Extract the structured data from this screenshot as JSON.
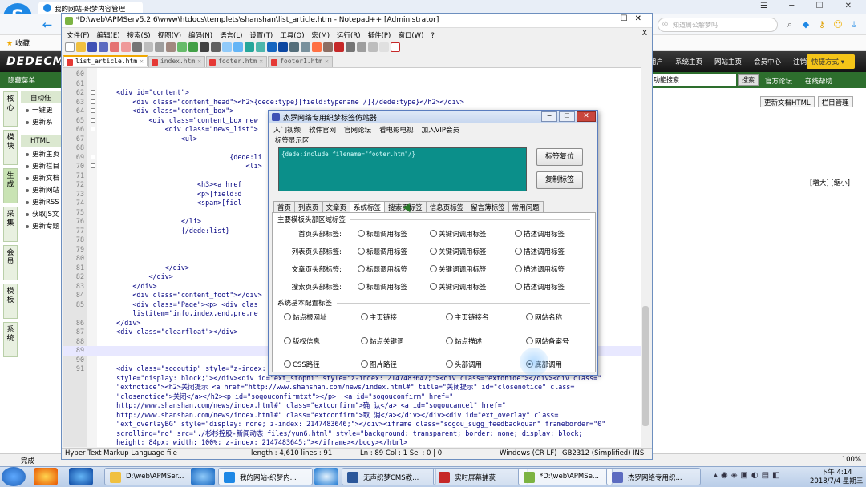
{
  "browser": {
    "tab_title": "我的网站-织梦内容管理",
    "search_placeholder": "知道周公解梦吗",
    "bookmarks_label": "收藏",
    "status_text": "完成",
    "zoom": "100%"
  },
  "dede": {
    "logo": "DEDECMS",
    "top_nav": [
      "用户",
      "系统主页",
      "网站主页",
      "会员中心",
      "注销"
    ],
    "quick_menu": "快捷方式 ▾",
    "subbar_left": "隐藏菜单",
    "func_search": "功能搜索",
    "search_btn": "搜索",
    "links": [
      "官方论坛",
      "在线帮助"
    ],
    "vnav": [
      "核心",
      "模块",
      "生成",
      "采集",
      "会员",
      "模板",
      "系统"
    ],
    "side_groups": [
      {
        "title": "自动任",
        "items": [
          "一键更",
          "更新系"
        ]
      },
      {
        "title": "HTML",
        "items": [
          "更新主页",
          "更新栏目",
          "更新文档",
          "更新网站",
          "更新RSS",
          "获取JS文",
          "更新专题"
        ]
      }
    ],
    "right_buttons": [
      "更新文档HTML",
      "栏目管理"
    ],
    "size_buttons": "[增大] [缩小]"
  },
  "npp": {
    "title": "*D:\\web\\APMServ5.2.6\\www\\htdocs\\templets\\shanshan\\list_article.htm - Notepad++ [Administrator]",
    "menu": [
      "文件(F)",
      "编辑(E)",
      "搜索(S)",
      "视图(V)",
      "编码(N)",
      "语言(L)",
      "设置(T)",
      "工具(O)",
      "宏(M)",
      "运行(R)",
      "插件(P)",
      "窗口(W)",
      "?"
    ],
    "menu_close": "X",
    "tabs": [
      {
        "label": "list_article.htm",
        "active": true
      },
      {
        "label": "index.htm",
        "active": false
      },
      {
        "label": "footer.htm",
        "active": false
      },
      {
        "label": "footer1.htm",
        "active": false
      }
    ],
    "lines": [
      {
        "n": "60",
        "t": ""
      },
      {
        "n": "61",
        "t": ""
      },
      {
        "n": "62",
        "t": "    <div id=\"content\">"
      },
      {
        "n": "63",
        "t": "        <div class=\"content_head\"><h2>{dede:type}[field:typename /]{/dede:type}</h2></div>"
      },
      {
        "n": "64",
        "t": "        <div class=\"content_box\">"
      },
      {
        "n": "65",
        "t": "            <div class=\"content_box new"
      },
      {
        "n": "66",
        "t": "                <div class=\"news_list\">"
      },
      {
        "n": "67",
        "t": "                    <ul>"
      },
      {
        "n": "68",
        "t": ""
      },
      {
        "n": "69",
        "t": "                                {dede:li"
      },
      {
        "n": "70",
        "t": "                                    <li>"
      },
      {
        "n": "71",
        "t": ""
      },
      {
        "n": "72",
        "t": "                        <h3><a href"
      },
      {
        "n": "73",
        "t": "                        <p>[field:d"
      },
      {
        "n": "74",
        "t": "                        <span>[fiel"
      },
      {
        "n": "75",
        "t": ""
      },
      {
        "n": "76",
        "t": "                    </li>"
      },
      {
        "n": "77",
        "t": "                    {/dede:list}"
      },
      {
        "n": "78",
        "t": ""
      },
      {
        "n": "79",
        "t": ""
      },
      {
        "n": "80",
        "t": ""
      },
      {
        "n": "81",
        "t": "                </div>"
      },
      {
        "n": "82",
        "t": "            </div>"
      },
      {
        "n": "83",
        "t": "        </div>"
      },
      {
        "n": "84",
        "t": "        <div class=\"content_foot\"></div>"
      },
      {
        "n": "85",
        "t": "        <div class=\"Page\"><p> <div clas"
      },
      {
        "n": "",
        "t": "        listitem=\"info,index,end,pre,ne"
      },
      {
        "n": "86",
        "t": "    </div>"
      },
      {
        "n": "87",
        "t": "    <div class=\"clearfloat\"></div>"
      },
      {
        "n": "88",
        "t": ""
      },
      {
        "n": "89",
        "t": ""
      },
      {
        "n": "90",
        "t": ""
      },
      {
        "n": "91",
        "t": "    <div class=\"sogoutip\" style=\"z-index: 2147483645; visibility: hidden; display: none;\"></div><div id=\"sogoubottom\""
      },
      {
        "n": "",
        "t": "    style=\"display: block;\"></div><div id=\"ext_stophi\" style=\"z-index: 2147483647;\"><div class=\"extohide\"></div><div class=\""
      },
      {
        "n": "",
        "t": "    \"extnotice\"><h2>关闭提示 <a href=\"http://www.shanshan.com/news/index.html#\" title=\"关闭提示\" id=\"closenotice\" class="
      },
      {
        "n": "",
        "t": "    \"closenotice\">关闭</a></h2><p id=\"sogouconfirmtxt\"></p>  <a id=\"sogouconfirm\" href=\""
      },
      {
        "n": "",
        "t": "    http://www.shanshan.com/news/index.html#\" class=\"extconfirm\">确 认</a> <a id=\"sogoucancel\" href=\""
      },
      {
        "n": "",
        "t": "    http://www.shanshan.com/news/index.html#\" class=\"extconfirm\">取 消</a></div></div><div id=\"ext_overlay\" class="
      },
      {
        "n": "",
        "t": "    \"ext_overlayBG\" style=\"display: none; z-index: 2147483646;\"></div><iframe class=\"sogou_sugg_feedbackquan\" frameborder=\"0\""
      },
      {
        "n": "",
        "t": "    scrolling=\"no\" src=\"./杉杉控股-新闻动态_files/yun6.html\" style=\"background: transparent; border: none; display: block;"
      },
      {
        "n": "",
        "t": "    height: 84px; width: 100%; z-index: 2147483645;\"></iframe></body></html>"
      }
    ],
    "status": {
      "type": "Hyper Text Markup Language file",
      "length": "length : 4,610    lines : 91",
      "pos": "Ln : 89    Col : 1    Sel : 0 | 0",
      "eol": "Windows (CR LF)",
      "enc": "GB2312 (Simplified)",
      "mode": "INS"
    }
  },
  "dialog": {
    "title": "杰罗网络专用织梦标签仿站器",
    "menu": [
      "入门视频",
      "软件官网",
      "官网论坛",
      "看电影电视",
      "加入VIP会员"
    ],
    "tag_area_label": "标签显示区",
    "tag_text": "{dede:include filename=\"footer.htm\"/}",
    "btn_reset": "标签复位",
    "btn_copy": "复制标签",
    "tabs": [
      "首页",
      "列表页",
      "文章页",
      "系统标签",
      "搜索页标签",
      "信息页标签",
      "留言薄标签",
      "常用问题"
    ],
    "active_tab": "系统标签",
    "group1_title": "主要模板头部区域标签",
    "group1_rows": [
      {
        "label": "首页头部标签:",
        "opts": [
          "标题调用标签",
          "关键词调用标签",
          "描述调用标签"
        ]
      },
      {
        "label": "列表页头部标签:",
        "opts": [
          "标题调用标签",
          "关键词调用标签",
          "描述调用标签"
        ]
      },
      {
        "label": "文章页头部标签:",
        "opts": [
          "标题调用标签",
          "关键词调用标签",
          "描述调用标签"
        ]
      },
      {
        "label": "搜索页头部标签:",
        "opts": [
          "标题调用标签",
          "关键词调用标签",
          "描述调用标签"
        ]
      }
    ],
    "group2_title": "系统基本配置标签",
    "group2_rows": [
      [
        "站点根网址",
        "主页链接",
        "主页链接名",
        "网站名称"
      ],
      [
        "版权信息",
        "站点关键词",
        "站点描述",
        "网站备案号"
      ],
      [
        "CSS路径",
        "图片路径",
        "头部调用",
        "底部调用"
      ]
    ],
    "selected_option": "底部调用"
  },
  "taskbar": {
    "tasks": [
      {
        "label": "D:\\web\\APMSer...",
        "color": "#f0c040"
      },
      {
        "label": "我的网站-织梦内...",
        "color": "#1e88e5"
      },
      {
        "label": "无声织梦CMS教...",
        "color": "#2b579a"
      },
      {
        "label": "实时屏幕捕获",
        "color": "#c62828"
      },
      {
        "label": "*D:\\web\\APMSe...",
        "color": "#7cb342"
      },
      {
        "label": "杰罗网络专用织...",
        "color": "#5c6bc0"
      }
    ],
    "time": "下午 4:14",
    "date": "2018/7/4 星期三"
  }
}
